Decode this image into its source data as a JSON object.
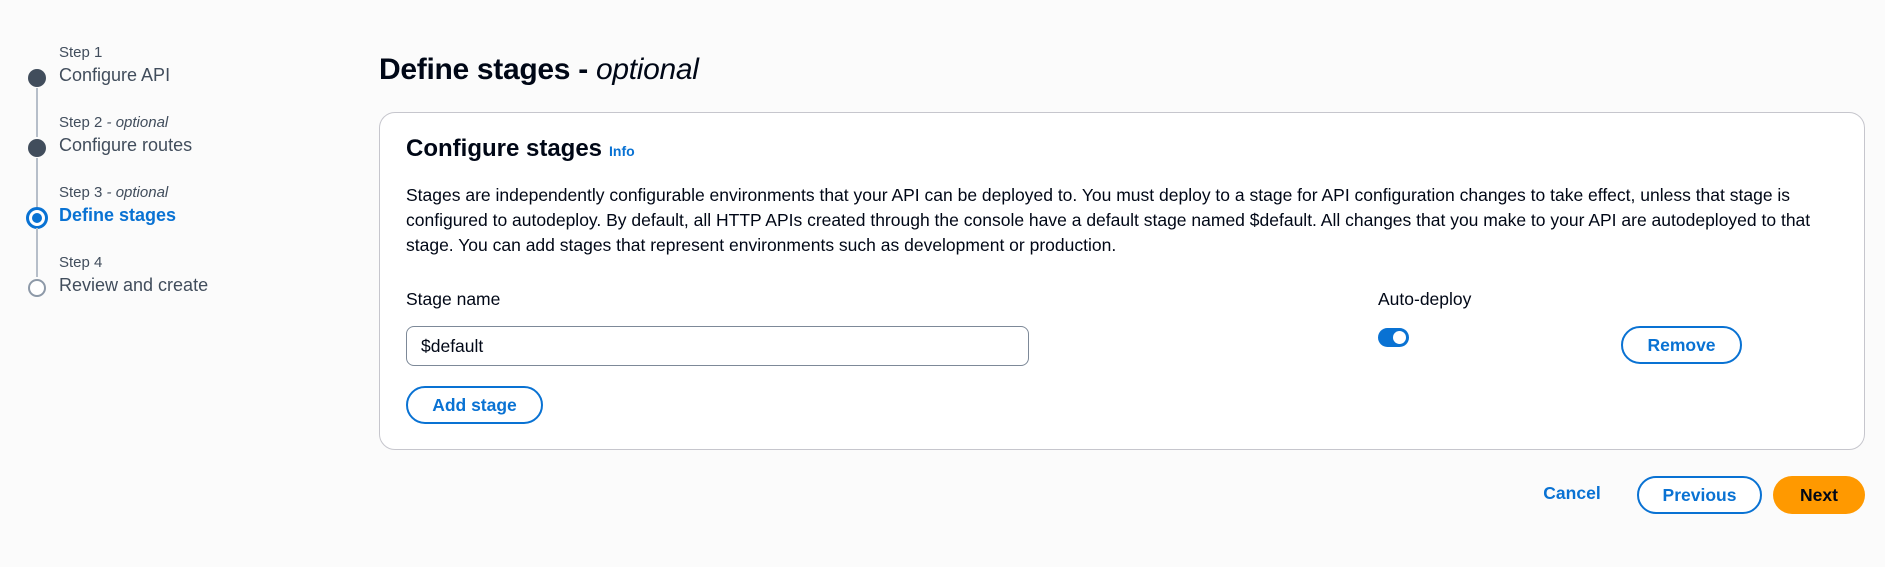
{
  "steps": [
    {
      "number": "Step 1",
      "optional": "",
      "title": "Configure API",
      "state": "complete"
    },
    {
      "number": "Step 2",
      "optional": " - optional",
      "title": "Configure routes",
      "state": "complete"
    },
    {
      "number": "Step 3",
      "optional": " - optional",
      "title": "Define stages",
      "state": "active"
    },
    {
      "number": "Step 4",
      "optional": "",
      "title": "Review and create",
      "state": "pending"
    }
  ],
  "page": {
    "title": "Define stages",
    "title_separator": " - ",
    "title_optional": "optional"
  },
  "container": {
    "title": "Configure stages",
    "info_link": "Info",
    "description": "Stages are independently configurable environments that your API can be deployed to. You must deploy to a stage for API configuration changes to take effect, unless that stage is configured to autodeploy. By default, all HTTP APIs created through the console have a default stage named $default. All changes that you make to your API are autodeployed to that stage. You can add stages that represent environments such as development or production.",
    "stage_name_label": "Stage name",
    "auto_deploy_label": "Auto-deploy",
    "stage_name_value": "$default",
    "auto_deploy_enabled": true,
    "remove_label": "Remove",
    "add_stage_label": "Add stage"
  },
  "footer": {
    "cancel_label": "Cancel",
    "previous_label": "Previous",
    "next_label": "Next"
  },
  "colors": {
    "accent": "#0972d3",
    "primary_button": "#ff9900",
    "step_complete": "#414d5c"
  }
}
